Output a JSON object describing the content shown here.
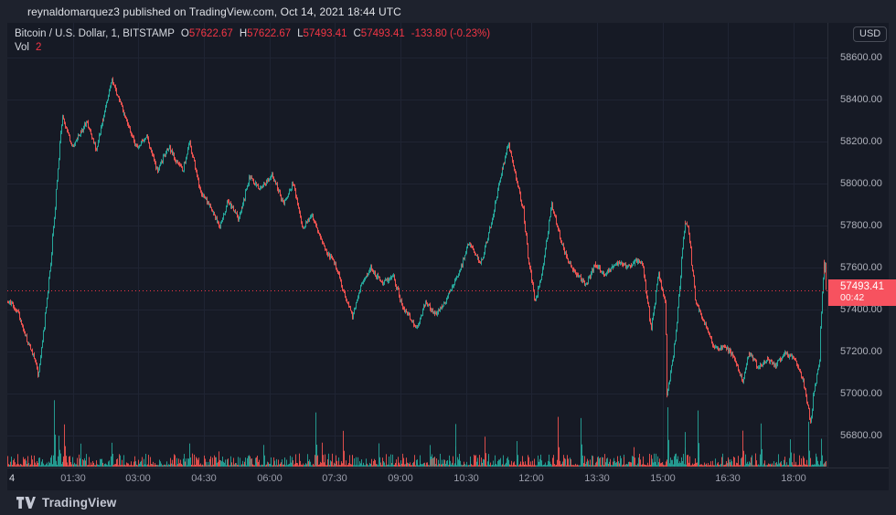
{
  "frame": {
    "top_bar_text": "reynaldomarquez3 published on TradingView.com, Oct 14, 2021 18:44 UTC",
    "bottom_logo_text": "TradingView"
  },
  "legend": {
    "title": "Bitcoin / U.S. Dollar, 1, BITSTAMP",
    "ohlc": [
      {
        "label": "O",
        "value": "57622.67"
      },
      {
        "label": "H",
        "value": "57622.67"
      },
      {
        "label": "L",
        "value": "57493.41"
      },
      {
        "label": "C",
        "value": "57493.41"
      }
    ],
    "change": "-133.80 (-0.23%)",
    "vol_label": "Vol",
    "vol_value": "2"
  },
  "axes": {
    "currency_badge": "USD",
    "price_ticks": [
      "58600.00",
      "58400.00",
      "58200.00",
      "58000.00",
      "57800.00",
      "57600.00",
      "57400.00",
      "57200.00",
      "57000.00",
      "56800.00"
    ],
    "time_ticks": [
      {
        "label": "4",
        "minute": 0,
        "major": true
      },
      {
        "label": "01:30",
        "minute": 90
      },
      {
        "label": "03:00",
        "minute": 180
      },
      {
        "label": "04:30",
        "minute": 270
      },
      {
        "label": "06:00",
        "minute": 360
      },
      {
        "label": "07:30",
        "minute": 450
      },
      {
        "label": "09:00",
        "minute": 540
      },
      {
        "label": "10:30",
        "minute": 630
      },
      {
        "label": "12:00",
        "minute": 720
      },
      {
        "label": "13:30",
        "minute": 810
      },
      {
        "label": "15:00",
        "minute": 900
      },
      {
        "label": "16:30",
        "minute": 990
      },
      {
        "label": "18:00",
        "minute": 1080
      }
    ]
  },
  "price_label": {
    "price": "57493.41",
    "countdown": "00:42"
  },
  "chart_data": {
    "type": "candlestick",
    "title": "Bitcoin / U.S. Dollar",
    "symbol": "BTCUSD",
    "exchange": "BITSTAMP",
    "interval_minutes": 1,
    "date": "Oct 14, 2021",
    "session_minutes": 1124,
    "current_bar": {
      "open": 57622.67,
      "high": 57622.67,
      "low": 57493.41,
      "close": 57493.41,
      "change": -133.8,
      "change_pct": -0.23,
      "volume": 2
    },
    "last_price": 57493.41,
    "y_axis": {
      "tick_max": 58600,
      "tick_min": 56800,
      "tick_step": 200
    },
    "day_high": 58520,
    "day_low": 56830,
    "price_path_anchors": [
      [
        0,
        57440
      ],
      [
        15,
        57370
      ],
      [
        38,
        57135
      ],
      [
        42,
        57060
      ],
      [
        59,
        57610
      ],
      [
        75,
        58330
      ],
      [
        90,
        58180
      ],
      [
        109,
        58310
      ],
      [
        122,
        58160
      ],
      [
        143,
        58500
      ],
      [
        160,
        58310
      ],
      [
        178,
        58160
      ],
      [
        191,
        58220
      ],
      [
        206,
        58070
      ],
      [
        222,
        58180
      ],
      [
        241,
        58070
      ],
      [
        250,
        58200
      ],
      [
        266,
        57960
      ],
      [
        291,
        57790
      ],
      [
        302,
        57895
      ],
      [
        317,
        57830
      ],
      [
        332,
        58025
      ],
      [
        345,
        57980
      ],
      [
        363,
        58050
      ],
      [
        379,
        57915
      ],
      [
        392,
        58005
      ],
      [
        405,
        57790
      ],
      [
        417,
        57850
      ],
      [
        432,
        57700
      ],
      [
        449,
        57615
      ],
      [
        461,
        57485
      ],
      [
        474,
        57375
      ],
      [
        486,
        57525
      ],
      [
        499,
        57615
      ],
      [
        515,
        57525
      ],
      [
        530,
        57570
      ],
      [
        543,
        57395
      ],
      [
        562,
        57310
      ],
      [
        574,
        57415
      ],
      [
        587,
        57375
      ],
      [
        602,
        57440
      ],
      [
        618,
        57570
      ],
      [
        633,
        57720
      ],
      [
        650,
        57635
      ],
      [
        666,
        57830
      ],
      [
        678,
        58050
      ],
      [
        688,
        58185
      ],
      [
        700,
        57980
      ],
      [
        708,
        57875
      ],
      [
        716,
        57615
      ],
      [
        725,
        57425
      ],
      [
        734,
        57570
      ],
      [
        747,
        57910
      ],
      [
        759,
        57745
      ],
      [
        769,
        57655
      ],
      [
        781,
        57570
      ],
      [
        794,
        57525
      ],
      [
        807,
        57615
      ],
      [
        819,
        57550
      ],
      [
        834,
        57615
      ],
      [
        851,
        57590
      ],
      [
        863,
        57635
      ],
      [
        872,
        57615
      ],
      [
        884,
        57310
      ],
      [
        894,
        57590
      ],
      [
        903,
        57440
      ],
      [
        906,
        57000
      ],
      [
        917,
        57265
      ],
      [
        930,
        57820
      ],
      [
        935,
        57790
      ],
      [
        945,
        57440
      ],
      [
        957,
        57330
      ],
      [
        970,
        57200
      ],
      [
        983,
        57220
      ],
      [
        995,
        57180
      ],
      [
        1010,
        57070
      ],
      [
        1018,
        57200
      ],
      [
        1030,
        57135
      ],
      [
        1043,
        57180
      ],
      [
        1055,
        57135
      ],
      [
        1068,
        57200
      ],
      [
        1081,
        57155
      ],
      [
        1093,
        57050
      ],
      [
        1103,
        56860
      ],
      [
        1108,
        57005
      ],
      [
        1115,
        57135
      ],
      [
        1121,
        57620
      ],
      [
        1124,
        57493.41
      ]
    ],
    "volume_spikes": [
      [
        64,
        78,
        1
      ],
      [
        70,
        36,
        1
      ],
      [
        78,
        52,
        -1
      ],
      [
        100,
        22,
        1
      ],
      [
        143,
        28,
        1
      ],
      [
        250,
        24,
        1
      ],
      [
        290,
        18,
        -1
      ],
      [
        352,
        26,
        1
      ],
      [
        423,
        60,
        1
      ],
      [
        432,
        26,
        -1
      ],
      [
        461,
        38,
        -1
      ],
      [
        510,
        26,
        1
      ],
      [
        580,
        22,
        1
      ],
      [
        615,
        48,
        1
      ],
      [
        656,
        30,
        -1
      ],
      [
        700,
        28,
        1
      ],
      [
        756,
        52,
        -1
      ],
      [
        788,
        55,
        1
      ],
      [
        860,
        22,
        -1
      ],
      [
        907,
        70,
        1
      ],
      [
        930,
        42,
        1
      ],
      [
        948,
        55,
        1
      ],
      [
        1010,
        36,
        -1
      ],
      [
        1035,
        46,
        1
      ],
      [
        1075,
        32,
        1
      ],
      [
        1100,
        45,
        1
      ],
      [
        1118,
        28,
        1
      ]
    ],
    "colors": {
      "up": "#26a69a",
      "down": "#ef5350",
      "price_line": "#f23645",
      "label_bg": "#f7525f",
      "grid": "#1f2433",
      "background": "#161a25",
      "frame": "#1e222d"
    },
    "grid": true,
    "legend_position": "top-left"
  }
}
